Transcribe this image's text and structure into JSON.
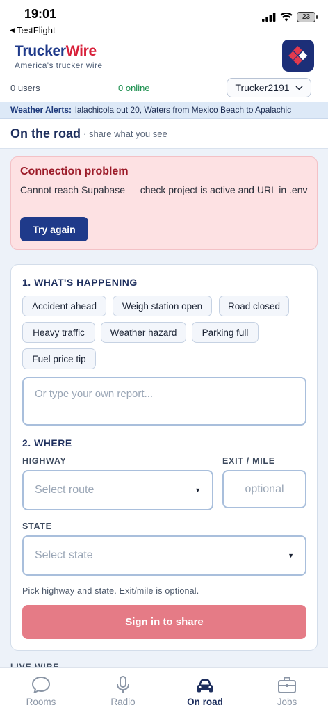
{
  "status_bar": {
    "time": "19:01",
    "back_app": "TestFlight",
    "battery": "23"
  },
  "header": {
    "brand_part1": "Trucker",
    "brand_part2": "Wire",
    "tagline": "America's trucker wire",
    "users": "0 users",
    "online": "0 online",
    "handle": "Trucker2191"
  },
  "ticker": {
    "label": "Weather Alerts:",
    "text": "lalachicola out 20, Waters from Mexico Beach to Apalachic"
  },
  "section": {
    "title": "On the road",
    "subtitle": "· share what you see"
  },
  "error": {
    "title": "Connection problem",
    "message": "Cannot reach Supabase — check project is active and URL in .env",
    "retry_label": "Try again"
  },
  "report": {
    "step1": "1. WHAT'S HAPPENING",
    "chips": [
      "Accident ahead",
      "Weigh station open",
      "Road closed",
      "Heavy traffic",
      "Weather hazard",
      "Parking full",
      "Fuel price tip"
    ],
    "custom_placeholder": "Or type your own report...",
    "step2": "2. WHERE",
    "highway_label": "HIGHWAY",
    "highway_placeholder": "Select route",
    "exit_label": "EXIT / MILE",
    "exit_placeholder": "optional",
    "state_label": "STATE",
    "state_placeholder": "Select state",
    "hint": "Pick highway and state. Exit/mile is optional.",
    "submit_label": "Sign in to share"
  },
  "live_label": "LIVE WIRE",
  "tabs": [
    {
      "label": "Rooms",
      "icon": "chat-bubble-icon"
    },
    {
      "label": "Radio",
      "icon": "microphone-icon"
    },
    {
      "label": "On road",
      "icon": "car-icon",
      "active": true
    },
    {
      "label": "Jobs",
      "icon": "briefcase-icon"
    }
  ],
  "colors": {
    "brand_blue": "#1f3a8a",
    "brand_red": "#d8203a",
    "error_bg": "#fde1e3",
    "submit_disabled": "#e57b86",
    "online_green": "#1c8f4e"
  }
}
